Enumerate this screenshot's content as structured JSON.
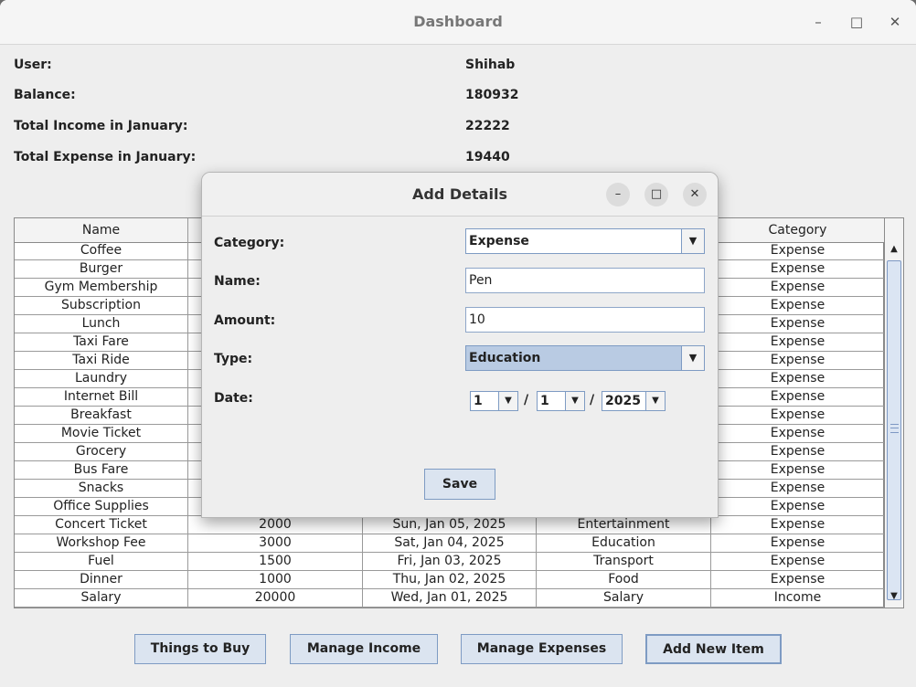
{
  "window": {
    "title": "Dashboard"
  },
  "info": [
    {
      "label": "User:",
      "value": "Shihab"
    },
    {
      "label": "Balance:",
      "value": "180932"
    },
    {
      "label": "Total Income in January:",
      "value": "22222"
    },
    {
      "label": "Total Expense in January:",
      "value": "19440"
    }
  ],
  "table": {
    "columns": [
      "Name",
      "",
      "",
      "",
      "Category"
    ],
    "rows": [
      [
        "Coffee",
        "",
        "",
        "",
        "Expense"
      ],
      [
        "Burger",
        "",
        "",
        "",
        "Expense"
      ],
      [
        "Gym Membership",
        "",
        "",
        "",
        "Expense"
      ],
      [
        "Subscription",
        "",
        "",
        "",
        "Expense"
      ],
      [
        "Lunch",
        "",
        "",
        "",
        "Expense"
      ],
      [
        "Taxi Fare",
        "",
        "",
        "",
        "Expense"
      ],
      [
        "Taxi Ride",
        "",
        "",
        "",
        "Expense"
      ],
      [
        "Laundry",
        "",
        "",
        "",
        "Expense"
      ],
      [
        "Internet Bill",
        "",
        "",
        "",
        "Expense"
      ],
      [
        "Breakfast",
        "",
        "",
        "",
        "Expense"
      ],
      [
        "Movie Ticket",
        "",
        "",
        "",
        "Expense"
      ],
      [
        "Grocery",
        "",
        "",
        "",
        "Expense"
      ],
      [
        "Bus Fare",
        "",
        "",
        "",
        "Expense"
      ],
      [
        "Snacks",
        "",
        "",
        "",
        "Expense"
      ],
      [
        "Office Supplies",
        "",
        "",
        "",
        "Expense"
      ],
      [
        "Concert Ticket",
        "2000",
        "Sun, Jan 05, 2025",
        "Entertainment",
        "Expense"
      ],
      [
        "Workshop Fee",
        "3000",
        "Sat, Jan 04, 2025",
        "Education",
        "Expense"
      ],
      [
        "Fuel",
        "1500",
        "Fri, Jan 03, 2025",
        "Transport",
        "Expense"
      ],
      [
        "Dinner",
        "1000",
        "Thu, Jan 02, 2025",
        "Food",
        "Expense"
      ],
      [
        "Salary",
        "20000",
        "Wed, Jan 01, 2025",
        "Salary",
        "Income"
      ]
    ]
  },
  "buttons": {
    "things_to_buy": "Things to Buy",
    "manage_income": "Manage Income",
    "manage_expenses": "Manage Expenses",
    "add_new_item": "Add New Item"
  },
  "dialog": {
    "title": "Add Details",
    "category_label": "Category:",
    "category_value": "Expense",
    "name_label": "Name:",
    "name_value": "Pen",
    "amount_label": "Amount:",
    "amount_value": "10",
    "type_label": "Type:",
    "type_value": "Education",
    "date_label": "Date:",
    "date_day": "1",
    "date_month": "1",
    "date_year": "2025",
    "date_separator": "/",
    "save_label": "Save"
  },
  "colors": {
    "accent": "#7e9bc3",
    "button_bg": "#dbe4f0",
    "selected": "#b9cbe3"
  }
}
